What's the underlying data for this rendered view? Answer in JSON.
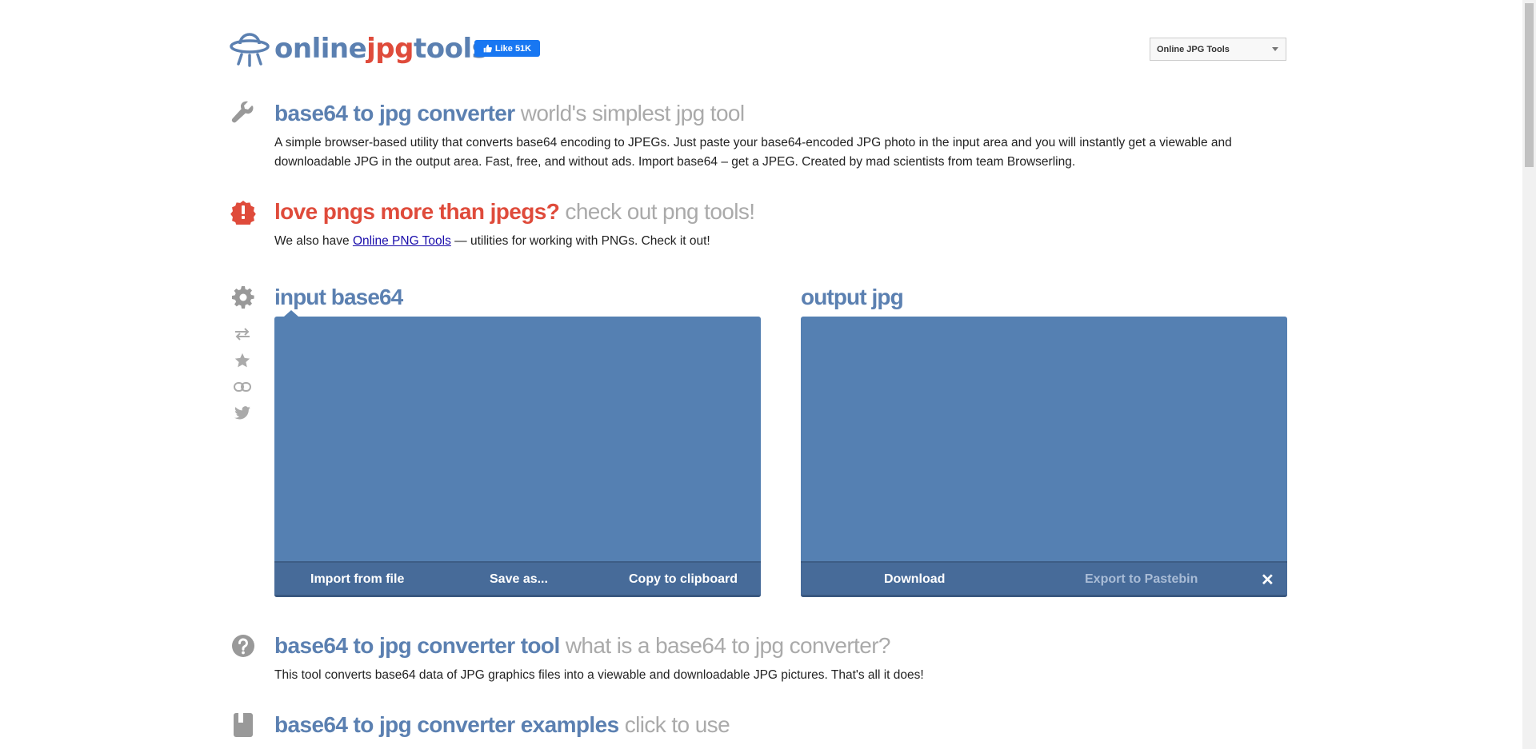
{
  "header": {
    "logo_part1": "online",
    "logo_part2": "jpg",
    "logo_part3": "tools",
    "fb_like": "Like 51K",
    "site_select": "Online JPG Tools"
  },
  "intro": {
    "title": "base64 to jpg converter",
    "subtitle": "world's simplest jpg tool",
    "text": "A simple browser-based utility that converts base64 encoding to JPEGs. Just paste your base64-encoded JPG photo in the input area and you will instantly get a viewable and downloadable JPG in the output area. Fast, free, and without ads. Import base64 – get a JPEG. Created by mad scientists from team Browserling."
  },
  "promo": {
    "title": "love pngs more than jpegs?",
    "subtitle": "check out png tools!",
    "text_before": "We also have ",
    "link": "Online PNG Tools",
    "text_after": " — utilities for working with PNGs. Check it out!"
  },
  "input_panel": {
    "title": "input base64",
    "buttons": [
      "Import from file",
      "Save as...",
      "Copy to clipboard"
    ]
  },
  "output_panel": {
    "title": "output jpg",
    "buttons": [
      "Download",
      "Export to Pastebin"
    ],
    "close_glyph": "✕"
  },
  "what_is": {
    "title": "base64 to jpg converter tool",
    "subtitle": "what is a base64 to jpg converter?",
    "text": "This tool converts base64 data of JPG graphics files into a viewable and downloadable JPG pictures. That's all it does!"
  },
  "examples": {
    "title": "base64 to jpg converter examples",
    "subtitle": "click to use"
  },
  "icons": {
    "wrench": "wrench-icon",
    "alert": "alert-icon",
    "gear": "gear-icon",
    "swap": "swap-icon",
    "star": "star-icon",
    "link": "link-icon",
    "twitter": "twitter-icon",
    "help": "help-icon",
    "book": "book-icon"
  },
  "colors": {
    "brand_blue": "#5b80b1",
    "brand_red": "#df4b3b",
    "panel_bg": "#5580b2",
    "panel_bar": "#476b99"
  }
}
